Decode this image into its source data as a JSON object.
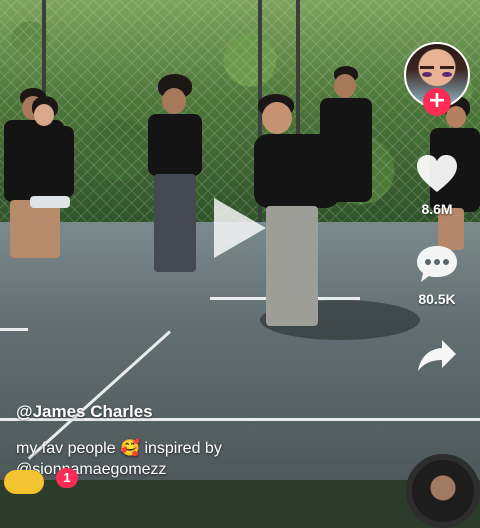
{
  "post": {
    "username": "@James Charles",
    "caption_text": "my fav people",
    "caption_emoji": "🥰",
    "caption_suffix": "inspired by",
    "mention": "@sionnamaegomezz"
  },
  "actions": {
    "follow_symbol": "+",
    "likes": "8.6M",
    "comments": "80.5K"
  },
  "badge": {
    "count": "1"
  },
  "colors": {
    "accent": "#fe2c55",
    "text": "#ffffff"
  },
  "icons": [
    "play-icon",
    "heart-icon",
    "comment-icon",
    "share-icon",
    "follow-plus-icon"
  ]
}
